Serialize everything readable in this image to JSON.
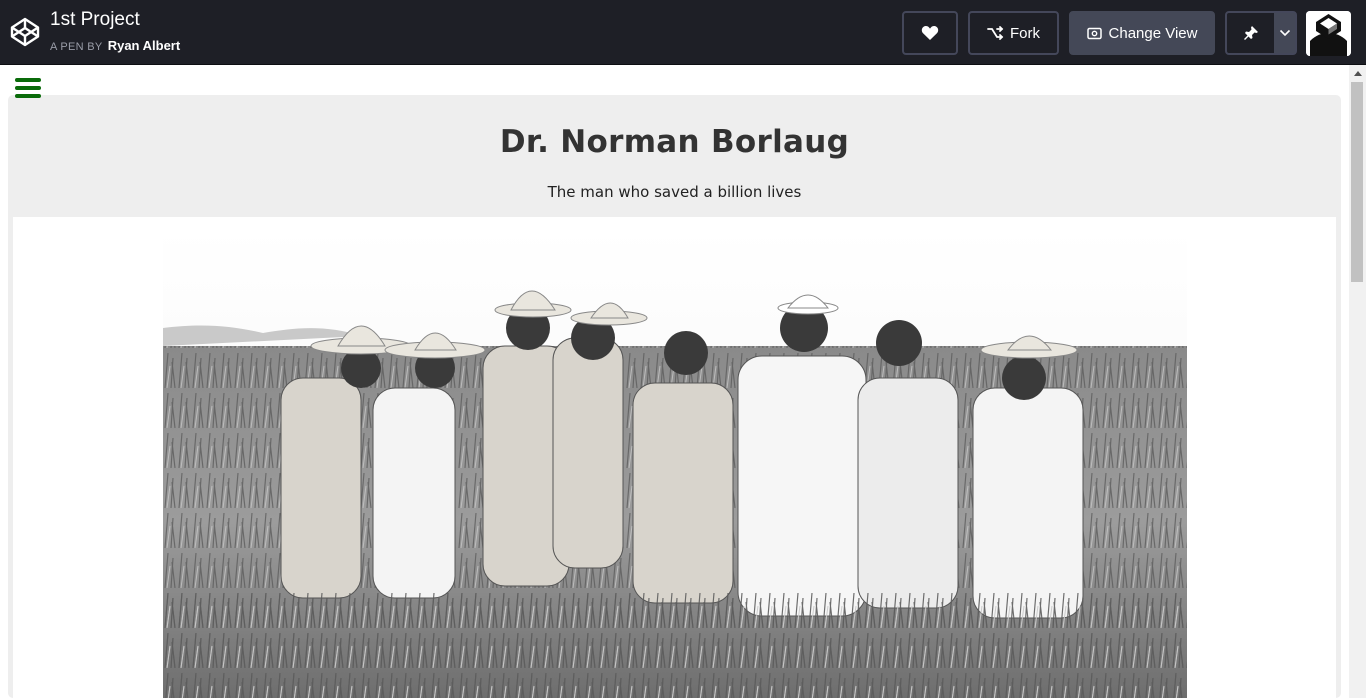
{
  "header": {
    "title": "1st Project",
    "byline_prefix": "A PEN BY",
    "author": "Ryan Albert",
    "buttons": {
      "like_icon": "heart-icon",
      "fork_label": "Fork",
      "change_view_label": "Change View",
      "pin_icon": "pin-icon",
      "menu_icon": "chevron-down-icon"
    }
  },
  "preview": {
    "menu_icon": "hamburger-icon",
    "heading": "Dr. Norman Borlaug",
    "subheading": "The man who saved a billion lives"
  },
  "colors": {
    "header_bg": "#1e1f26",
    "button_border": "#44475a",
    "accent_green": "#0a6b0a",
    "panel_bg": "#eeeeee"
  }
}
